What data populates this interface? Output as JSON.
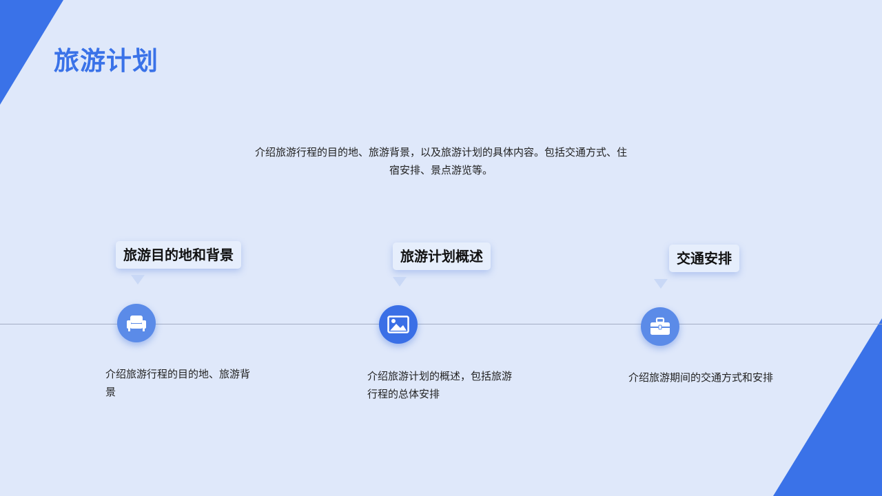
{
  "title": "旅游计划",
  "intro": "介绍旅游行程的目的地、旅游背景，以及旅游计划的具体内容。包括交通方式、住宿安排、景点游览等。",
  "items": [
    {
      "label": "旅游目的地和背景",
      "icon": "sofa-icon",
      "description": "介绍旅游行程的目的地、旅游背景"
    },
    {
      "label": "旅游计划概述",
      "icon": "image-icon",
      "description": "介绍旅游计划的概述，包括旅游行程的总体安排"
    },
    {
      "label": "交通安排",
      "icon": "briefcase-icon",
      "description": "介绍旅游期间的交通方式和安排"
    }
  ],
  "colors": {
    "background": "#dfe8fa",
    "accent": "#3a72e8",
    "node_light": "#5b8be8",
    "node_dark": "#3a6fe6"
  }
}
